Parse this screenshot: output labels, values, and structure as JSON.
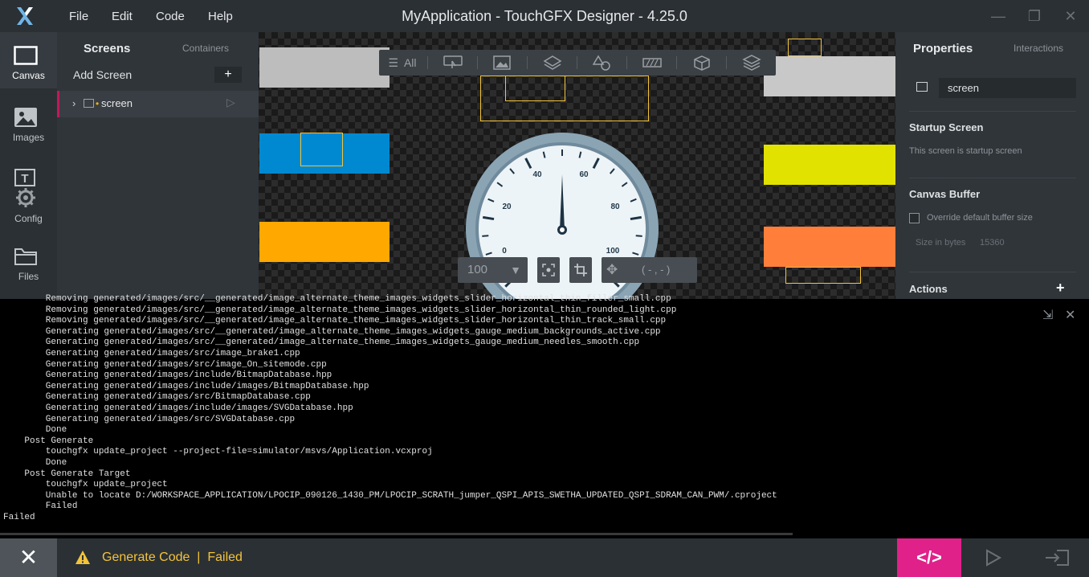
{
  "app": {
    "title": "MyApplication - TouchGFX Designer - 4.25.0",
    "menu": [
      "File",
      "Edit",
      "Code",
      "Help"
    ],
    "window_controls": {
      "minimize": "—",
      "restore": "❐",
      "close": "✕"
    }
  },
  "leftnav": {
    "canvas": "Canvas",
    "images": "Images",
    "texts": "Texts",
    "config": "Config",
    "files": "Files"
  },
  "screens_panel": {
    "tab_screens": "Screens",
    "tab_containers": "Containers",
    "add_screen": "Add Screen",
    "add_button": "+",
    "screen_item": {
      "chevron": "›",
      "name": "screen",
      "play": "▷"
    }
  },
  "canvas": {
    "toolbar_all": "All",
    "zoom_value": "100",
    "coordinates": "( - , - )",
    "gauge": {
      "tick_labels": [
        "0",
        "20",
        "40",
        "60",
        "80",
        "100"
      ],
      "needle_value": 50
    },
    "colors": {
      "gray": "#bdbdbd",
      "blue": "#0089d1",
      "orange": "#ffa800",
      "light_gray": "#c8c8c8",
      "yellow": "#e2e200",
      "coral": "#ff7f3a",
      "selection": "#f3c33a"
    }
  },
  "properties": {
    "tab_properties": "Properties",
    "tab_interactions": "Interactions",
    "name_value": "screen",
    "startup_title": "Startup Screen",
    "startup_text": "This screen is startup screen",
    "buffer_title": "Canvas Buffer",
    "override_label": "Override default buffer size",
    "size_label": "Size in bytes",
    "size_value": "15360",
    "actions_title": "Actions",
    "actions_add": "+"
  },
  "console": {
    "lines": [
      "        Removing generated/images/src/__generated/image_alternate_theme_images_widgets_slider_horizontal_thin_filler_small.cpp",
      "        Removing generated/images/src/__generated/image_alternate_theme_images_widgets_slider_horizontal_thin_rounded_light.cpp",
      "        Removing generated/images/src/__generated/image_alternate_theme_images_widgets_slider_horizontal_thin_track_small.cpp",
      "        Generating generated/images/src/__generated/image_alternate_theme_images_widgets_gauge_medium_backgrounds_active.cpp",
      "        Generating generated/images/src/__generated/image_alternate_theme_images_widgets_gauge_medium_needles_smooth.cpp",
      "        Generating generated/images/src/image_brake1.cpp",
      "        Generating generated/images/src/image_On_sitemode.cpp",
      "        Generating generated/images/include/BitmapDatabase.hpp",
      "        Generating generated/images/include/images/BitmapDatabase.hpp",
      "        Generating generated/images/src/BitmapDatabase.cpp",
      "        Generating generated/images/include/images/SVGDatabase.hpp",
      "        Generating generated/images/src/SVGDatabase.cpp",
      "        Done",
      "    Post Generate",
      "        touchgfx update_project --project-file=simulator/msvs/Application.vcxproj",
      "        Done",
      "    Post Generate Target",
      "        touchgfx update_project",
      "        Unable to locate D:/WORKSPACE_APPLICATION/LPOCIP_090126_1430_PM/LPOCIP_SCRATH_jumper_QSPI_APIS_SWETHA_UPDATED_QSPI_SDRAM_CAN_PWM/.cproject",
      "        Failed",
      "Failed"
    ]
  },
  "status": {
    "close": "✕",
    "text": "Generate Code  |  Failed",
    "code_button": "</>",
    "run_icon": "▷",
    "exit_icon": "⇥"
  }
}
